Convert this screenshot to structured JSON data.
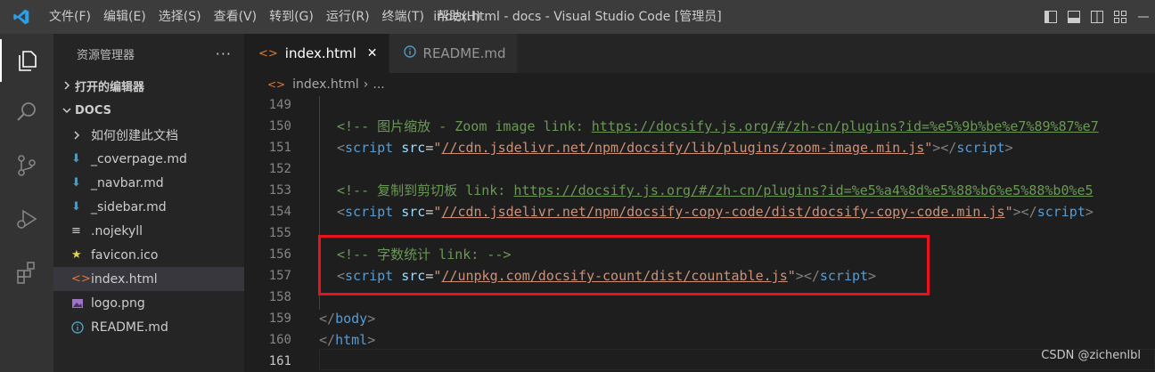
{
  "menu": [
    "文件(F)",
    "编辑(E)",
    "选择(S)",
    "查看(V)",
    "转到(G)",
    "运行(R)",
    "终端(T)",
    "帮助(H)"
  ],
  "window_title": "index.html - docs - Visual Studio Code [管理员]",
  "sidebar": {
    "title": "资源管理器",
    "more": "···",
    "open_editors": "打开的编辑器",
    "folder": "DOCS",
    "items": [
      {
        "label": "如何创建此文档",
        "icon": "chevron-right-icon"
      },
      {
        "label": "_coverpage.md",
        "icon": "markdown-icon"
      },
      {
        "label": "_navbar.md",
        "icon": "markdown-icon"
      },
      {
        "label": "_sidebar.md",
        "icon": "markdown-icon"
      },
      {
        "label": ".nojekyll",
        "icon": "text-file-icon"
      },
      {
        "label": "favicon.ico",
        "icon": "star-icon"
      },
      {
        "label": "index.html",
        "icon": "html-icon"
      },
      {
        "label": "logo.png",
        "icon": "image-icon"
      },
      {
        "label": "README.md",
        "icon": "info-icon"
      }
    ]
  },
  "tabs": [
    {
      "label": "index.html",
      "close": "✕"
    },
    {
      "label": "README.md"
    }
  ],
  "breadcrumb": {
    "file": "index.html",
    "sep": "›",
    "rest": "..."
  },
  "code": {
    "numbers": [
      "149",
      "150",
      "151",
      "152",
      "153",
      "154",
      "155",
      "156",
      "157",
      "158",
      "159",
      "160",
      "161"
    ],
    "l150_open": "<!-- ",
    "l150_text": "图片缩放 - Zoom image link: ",
    "l150_link": "https://docsify.js.org/#/zh-cn/plugins?id=%e5%9b%be%e7%89%87%e7",
    "l151_src": "//cdn.jsdelivr.net/npm/docsify/lib/plugins/zoom-image.min.js",
    "l153_open": "<!-- ",
    "l153_text": "复制到剪切板 link: ",
    "l153_link": "https://docsify.js.org/#/zh-cn/plugins?id=%e5%a4%8d%e5%88%b6%e5%88%b0%e5",
    "l154_src": "//cdn.jsdelivr.net/npm/docsify-copy-code/dist/docsify-copy-code.min.js",
    "l156": "<!-- 字数统计 link: -->",
    "l157_src": "//unpkg.com/docsify-count/dist/countable.js",
    "tag_script": "script",
    "attr_src": "src",
    "tag_body": "body",
    "tag_html": "html"
  },
  "watermark": "CSDN @zichenlbl",
  "colors": {
    "highlight": "#e8111d",
    "accent": "#007acc"
  }
}
